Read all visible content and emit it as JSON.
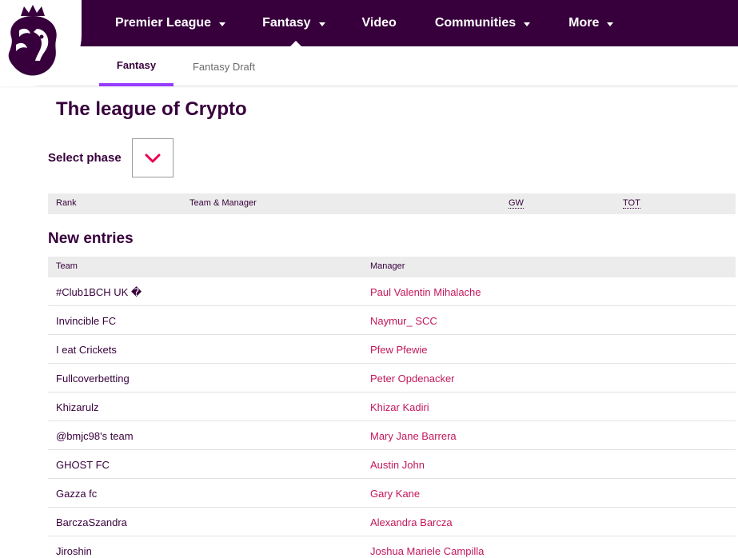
{
  "colors": {
    "brand": "#37003c",
    "accent": "#963cff",
    "link": "#c2185b",
    "chevron": "#e90052"
  },
  "nav": {
    "items": [
      {
        "label": "Premier League",
        "has_caret": true,
        "icon": "chevron-down-icon"
      },
      {
        "label": "Fantasy",
        "has_caret": true,
        "icon": "chevron-down-icon",
        "active": true
      },
      {
        "label": "Video",
        "has_caret": false
      },
      {
        "label": "Communities",
        "has_caret": true,
        "icon": "chevron-down-icon"
      },
      {
        "label": "More",
        "has_caret": true,
        "icon": "chevron-down-icon"
      }
    ]
  },
  "subnav": {
    "tabs": [
      {
        "label": "Fantasy",
        "active": true
      },
      {
        "label": "Fantasy Draft",
        "active": false
      }
    ]
  },
  "page": {
    "title": "The league of Crypto",
    "select_phase_label": "Select phase",
    "select_icon": "chevron-down-icon"
  },
  "standings": {
    "headers": {
      "rank": "Rank",
      "team_manager": "Team & Manager",
      "gw": "GW",
      "tot": "TOT"
    }
  },
  "new_entries": {
    "title": "New entries",
    "headers": {
      "team": "Team",
      "manager": "Manager"
    },
    "rows": [
      {
        "team": "#Club1BCH UK �",
        "manager": "Paul Valentin Mihalache"
      },
      {
        "team": "Invincible FC",
        "manager": "Naymur_ SCC"
      },
      {
        "team": "I eat Crickets",
        "manager": "Pfew Pfewie"
      },
      {
        "team": "Fullcoverbetting",
        "manager": "Peter Opdenacker"
      },
      {
        "team": "Khizarulz",
        "manager": "Khizar Kadiri"
      },
      {
        "team": "@bmjc98's team",
        "manager": "Mary Jane Barrera"
      },
      {
        "team": "GHOST FC",
        "manager": "Austin John"
      },
      {
        "team": "Gazza fc",
        "manager": "Gary Kane"
      },
      {
        "team": "BarczaSzandra",
        "manager": "Alexandra Barcza"
      },
      {
        "team": "Jiroshin",
        "manager": "Joshua Mariele Campilla"
      }
    ]
  }
}
